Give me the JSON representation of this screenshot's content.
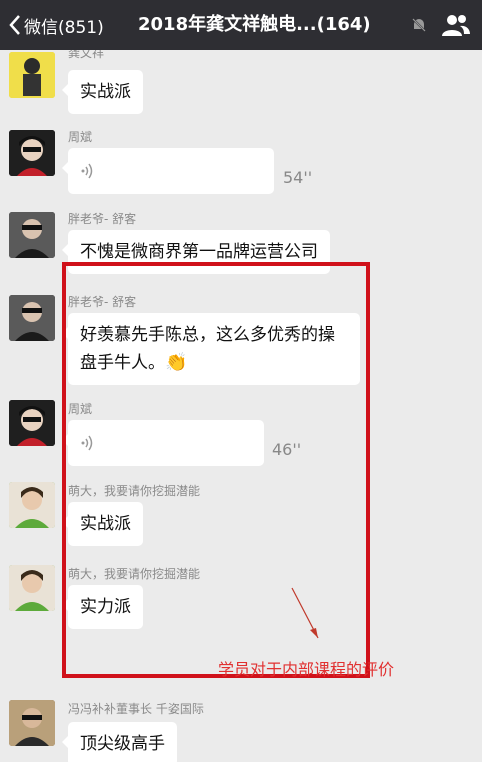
{
  "header": {
    "back_label": "微信(851)",
    "title": "2018年龚文祥触电...(164)"
  },
  "messages": [
    {
      "sender": "龚文祥",
      "text": "实战派"
    },
    {
      "sender": "周斌",
      "type": "voice",
      "duration": "54''"
    },
    {
      "sender": "胖老爷- 舒客",
      "text": "不愧是微商界第一品牌运营公司"
    },
    {
      "sender": "胖老爷- 舒客",
      "text_line1": "好羡慕先手陈总，这么多优秀的操",
      "text_line2": "盘手牛人。"
    },
    {
      "sender": "周斌",
      "type": "voice",
      "duration": "46''"
    },
    {
      "sender": "萌大，我要请你挖掘潜能",
      "text": "实战派"
    },
    {
      "sender": "萌大，我要请你挖掘潜能",
      "text": "实力派"
    },
    {
      "sender": "冯冯补补董事长 千姿国际",
      "text": "顶尖级高手"
    }
  ],
  "annotation": "学员对于内部课程的评价",
  "colors": {
    "highlight_box": "#d0111a",
    "annotation_text": "#e13030",
    "nav_bg": "#2e2e33"
  }
}
